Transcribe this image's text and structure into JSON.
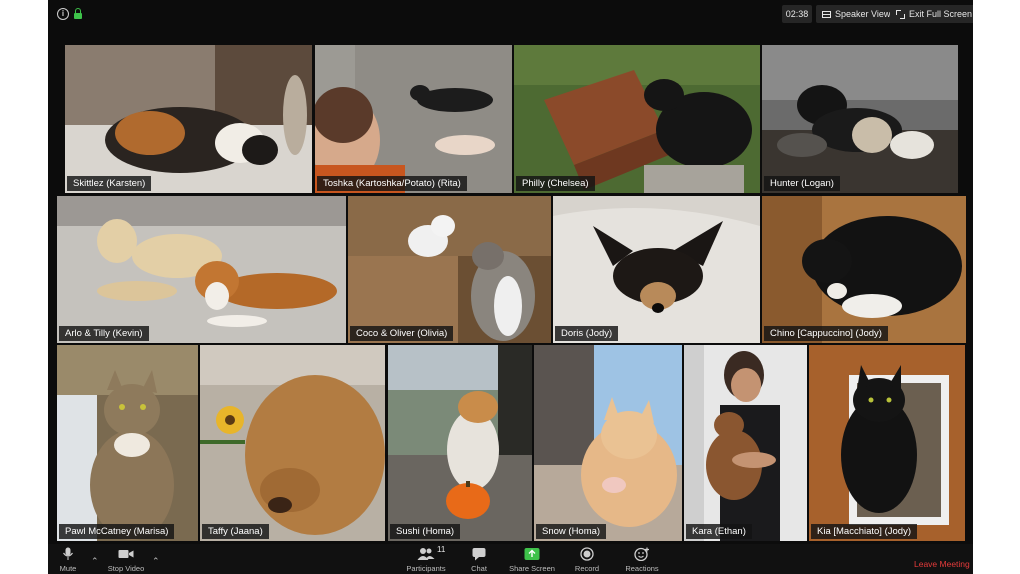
{
  "topbar": {
    "timer": "02:38",
    "speaker_view": "Speaker View",
    "exit_full_screen": "Exit Full Screen",
    "icons": [
      "info-icon",
      "lock-icon",
      "grid-icon",
      "expand-icon"
    ]
  },
  "participants": [
    {
      "name": "Skittlez (Karsten)"
    },
    {
      "name": "Toshka (Kartoshka/Potato) (Rita)"
    },
    {
      "name": "Philly (Chelsea)"
    },
    {
      "name": "Hunter (Logan)"
    },
    {
      "name": "Arlo & Tilly (Kevin)"
    },
    {
      "name": "Coco & Oliver (Olivia)"
    },
    {
      "name": "Doris (Jody)"
    },
    {
      "name": "Chino [Cappuccino] (Jody)"
    },
    {
      "name": "Pawl McCatney (Marisa)"
    },
    {
      "name": "Taffy (Jaana)"
    },
    {
      "name": "Sushi (Homa)"
    },
    {
      "name": "Snow (Homa)"
    },
    {
      "name": "Kara (Ethan)"
    },
    {
      "name": "Kia [Macchiato] (Jody)"
    }
  ],
  "toolbar": {
    "mute": "Mute",
    "stop_video": "Stop Video",
    "participants": "Participants",
    "participants_count": "11",
    "chat": "Chat",
    "share_screen": "Share Screen",
    "record": "Record",
    "reactions": "Reactions",
    "leave_meeting": "Leave Meeting"
  },
  "colors": {
    "window_bg": "#0c0c0c",
    "share_green": "#3ec24a",
    "leave_red": "#e53b3b"
  }
}
